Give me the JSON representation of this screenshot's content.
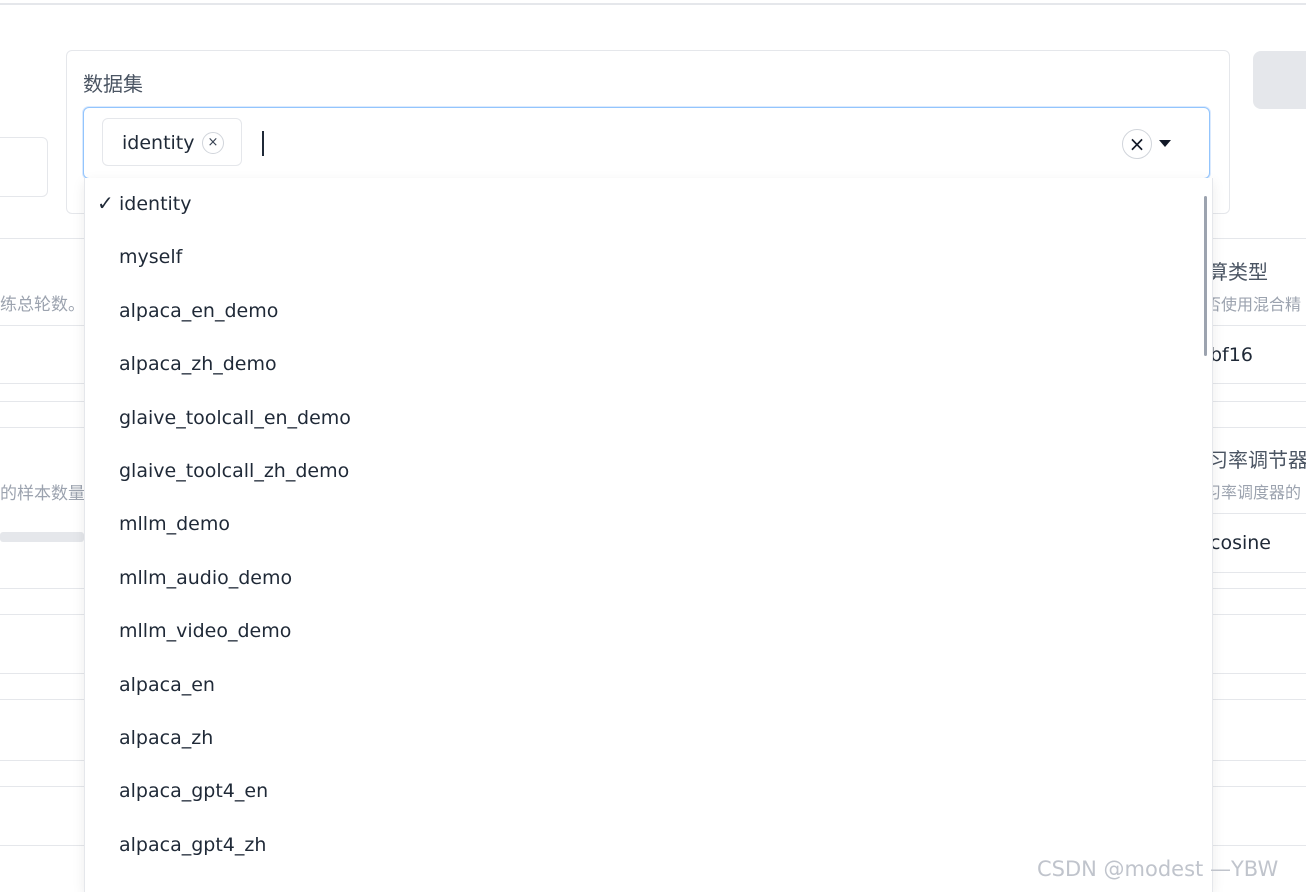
{
  "dataset": {
    "label": "数据集",
    "selected_tag": "identity",
    "tag_remove_icon": "×",
    "clear_icon": "×",
    "options": [
      {
        "label": "identity",
        "selected": true
      },
      {
        "label": "myself",
        "selected": false
      },
      {
        "label": "alpaca_en_demo",
        "selected": false
      },
      {
        "label": "alpaca_zh_demo",
        "selected": false
      },
      {
        "label": "glaive_toolcall_en_demo",
        "selected": false
      },
      {
        "label": "glaive_toolcall_zh_demo",
        "selected": false
      },
      {
        "label": "mllm_demo",
        "selected": false
      },
      {
        "label": "mllm_audio_demo",
        "selected": false
      },
      {
        "label": "mllm_video_demo",
        "selected": false
      },
      {
        "label": "alpaca_en",
        "selected": false
      },
      {
        "label": "alpaca_zh",
        "selected": false
      },
      {
        "label": "alpaca_gpt4_en",
        "selected": false
      },
      {
        "label": "alpaca_gpt4_zh",
        "selected": false
      }
    ],
    "check_mark": "✓"
  },
  "left_panel": {
    "epochs_info": "练总轮数。",
    "samples_info": "的样本数量"
  },
  "right_panel": {
    "compute_type_label": "算类型",
    "compute_type_info": "否使用混合精",
    "compute_type_value": "bf16",
    "lr_scheduler_label": "习率调节器",
    "lr_scheduler_info": "习率调度器的",
    "lr_scheduler_value": "cosine"
  },
  "watermark": "CSDN @modest —YBW"
}
